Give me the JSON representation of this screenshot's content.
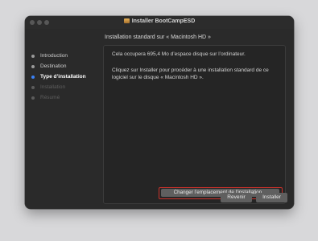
{
  "window": {
    "title": "Installer BootCampESD",
    "subtitle": "Installation standard sur « Macintosh HD »"
  },
  "sidebar": {
    "steps": [
      {
        "label": "Introduction",
        "state": "done"
      },
      {
        "label": "Destination",
        "state": "done"
      },
      {
        "label": "Type d’installation",
        "state": "current"
      },
      {
        "label": "Installation",
        "state": "future"
      },
      {
        "label": "Résumé",
        "state": "future"
      }
    ]
  },
  "content": {
    "paragraph1": "Cela occupera 695,4 Mo d’espace disque sur l’ordinateur.",
    "paragraph2": "Cliquez sur Installer pour procéder à une installation standard de ce logiciel sur le disque « Macintosh HD ».",
    "change_location_label": "Changer l’emplacement de l’installation…"
  },
  "buttons": {
    "back_label": "Revenir",
    "install_label": "Installer"
  },
  "colors": {
    "accent": "#3b82f6",
    "highlight_border": "#c8312a"
  }
}
